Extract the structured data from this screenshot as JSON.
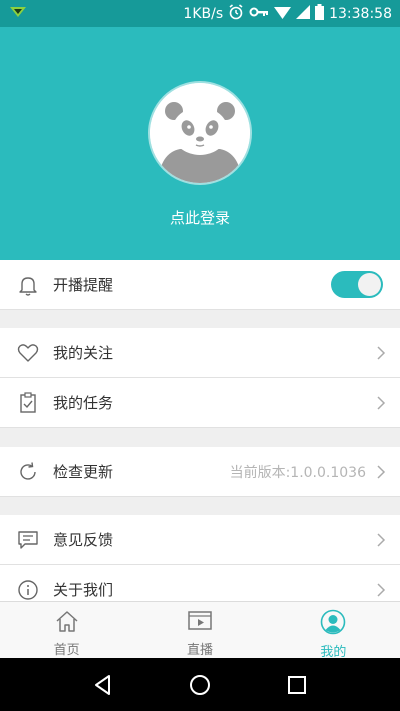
{
  "status_bar": {
    "net_speed": "1KB/s",
    "time": "13:38:58"
  },
  "header": {
    "login_text": "点此登录"
  },
  "settings": {
    "live_reminder": {
      "label": "开播提醒",
      "enabled": true
    },
    "my_follows": {
      "label": "我的关注"
    },
    "my_tasks": {
      "label": "我的任务"
    },
    "check_update": {
      "label": "检查更新",
      "value": "当前版本:1.0.0.1036"
    },
    "feedback": {
      "label": "意见反馈"
    },
    "about": {
      "label": "关于我们"
    }
  },
  "tabs": [
    {
      "label": "首页",
      "icon": "home-icon",
      "active": false
    },
    {
      "label": "直播",
      "icon": "video-icon",
      "active": false
    },
    {
      "label": "我的",
      "icon": "profile-icon",
      "active": true
    }
  ],
  "colors": {
    "accent": "#2bbbbd",
    "status_bar": "#169a99"
  }
}
